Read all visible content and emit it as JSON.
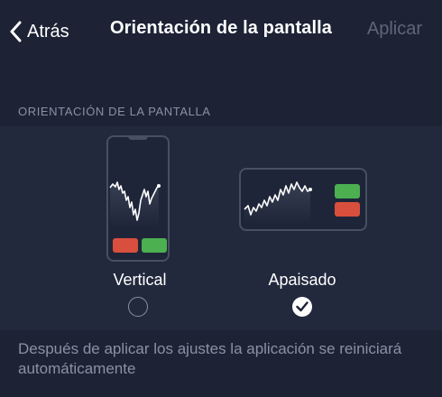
{
  "header": {
    "back_label": "Atrás",
    "title": "Orientación de la pantalla",
    "apply_label": "Aplicar"
  },
  "section": {
    "label": "ORIENTACIÓN DE LA PANTALLA"
  },
  "options": [
    {
      "label": "Vertical",
      "selected": false
    },
    {
      "label": "Apaisado",
      "selected": true
    }
  ],
  "footer": {
    "note": "Después de aplicar los ajustes la aplicación se reiniciará automáticamente"
  },
  "icons": {
    "back": "chevron-left-icon",
    "check": "checkmark-icon"
  },
  "colors": {
    "background": "#1d2335",
    "panel": "#22293d",
    "sell": "#d94f3d",
    "buy": "#4caf50",
    "muted_text": "#8a91a3",
    "disabled_text": "#5f6678"
  }
}
